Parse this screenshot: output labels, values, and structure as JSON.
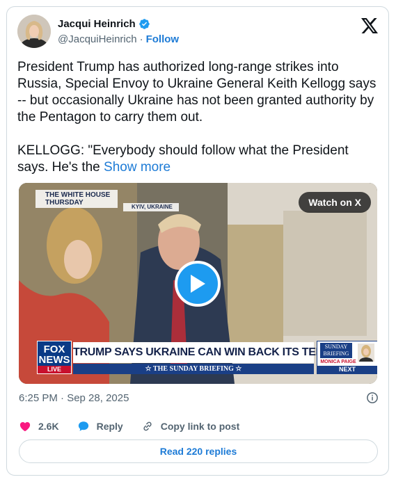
{
  "author": {
    "name": "Jacqui Heinrich",
    "handle": "@JacquiHeinrich",
    "separator": "·",
    "follow_label": "Follow"
  },
  "post": {
    "text": "President Trump has authorized long-range strikes into Russia, Special Envoy to Ukraine General Keith Kellogg says -- but occasionally Ukraine has not been granted authority by the Pentagon to carry them out.\n\nKELLOGG: \"Everybody should follow what the President says. He's the ",
    "show_more_label": "Show more"
  },
  "media": {
    "watch_label": "Watch on X",
    "overlay_location": "THE WHITE HOUSE\nTHURSDAY",
    "overlay_kyiv": "KYIV, UKRAINE",
    "network_logo": "FOX\nNEWS",
    "network_live": "LIVE",
    "headline": "TRUMP SAYS UKRAINE CAN WIN BACK ITS TERRITORY",
    "show_name": "☆ THE SUNDAY BRIEFING ☆",
    "next_show": "SUNDAY\nBRIEFING",
    "next_host": "MONICA PAIGE",
    "next_label": "NEXT"
  },
  "timestamp": "6:25 PM · Sep 28, 2025",
  "actions": {
    "likes": "2.6K",
    "reply_label": "Reply",
    "copy_label": "Copy link to post"
  },
  "read_replies_label": "Read 220 replies",
  "colors": {
    "link_blue": "#1d7bd6",
    "verified_blue": "#1d9bf0",
    "heart_pink": "#f91880",
    "fox_navy": "#1a3f86"
  }
}
